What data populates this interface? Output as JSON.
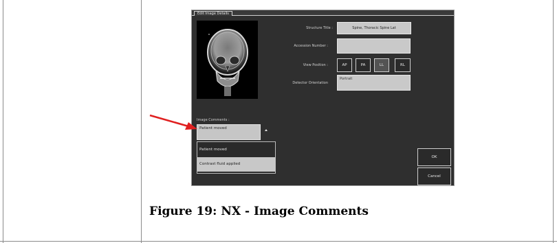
{
  "dialog": {
    "title": "Edit Image Details",
    "fields": {
      "structure_title_label": "Structure Title :",
      "structure_title_value": "Spine, Thoracic Spine Lat",
      "accession_number_label": "Accession Number :",
      "accession_number_value": "",
      "view_position_label": "View Position :",
      "view_positions": [
        "AP",
        "PA",
        "LL",
        "RL"
      ],
      "view_position_selected": "LL",
      "detector_orientation_label": "Detector Orientation",
      "detector_orientation_value": "Portrait",
      "image_comments_label": "Image Comments :",
      "image_comments_value": "Patient moved"
    },
    "dropdown_options": [
      "Patient moved",
      "Contrast fluid applied"
    ],
    "buttons": {
      "ok": "OK",
      "cancel": "Cancel"
    }
  },
  "caption": "Figure 19: NX - Image Comments",
  "colors": {
    "arrow": "#e02020",
    "dialog_bg": "#2f2f2f",
    "field_bg": "#c9c9c9"
  }
}
